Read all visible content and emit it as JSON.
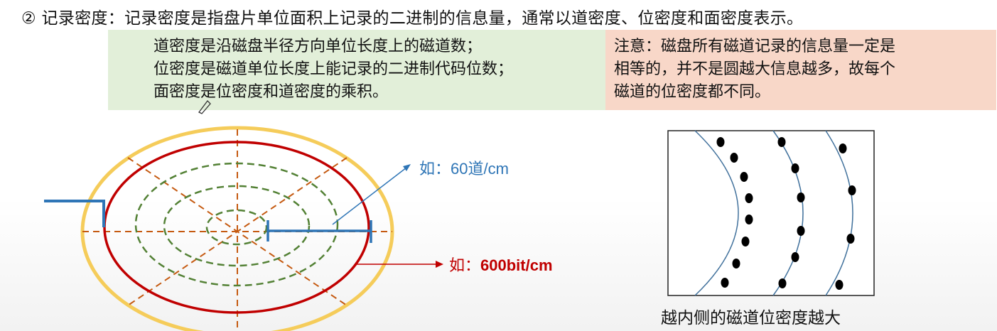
{
  "heading": "② 记录密度：记录密度是指盘片单位面积上记录的二进制的信息量，通常以道密度、位密度和面密度表示。",
  "definitions": [
    "道密度是沿磁盘半径方向单位长度上的磁道数；",
    "位密度是磁道单位长度上能记录的二进制代码位数；",
    "面密度是位密度和道密度的乘积。"
  ],
  "note": [
    "注意：磁盘所有磁道记录的信息量一定是",
    "相等的，并不是圆越大信息越多，故每个",
    "磁道的位密度都不同。"
  ],
  "disk_diagram": {
    "track_example_prefix": "如：",
    "track_example_value": "60道/cm",
    "bit_example_prefix": "如：",
    "bit_example_value": "600bit/cm"
  },
  "tracks_caption": "越内侧的磁道位密度越大",
  "colors": {
    "platter_rim": "#f5cc5a",
    "outer_track": "#c00000",
    "inner_tracks": "#538135",
    "sector_lines": "#c55a11",
    "head_arm": "#2e75b6",
    "track_label": "#2e75b6",
    "bit_label": "#c00000",
    "green_box": "#e2efd9",
    "pink_box": "#f8d7c8"
  }
}
